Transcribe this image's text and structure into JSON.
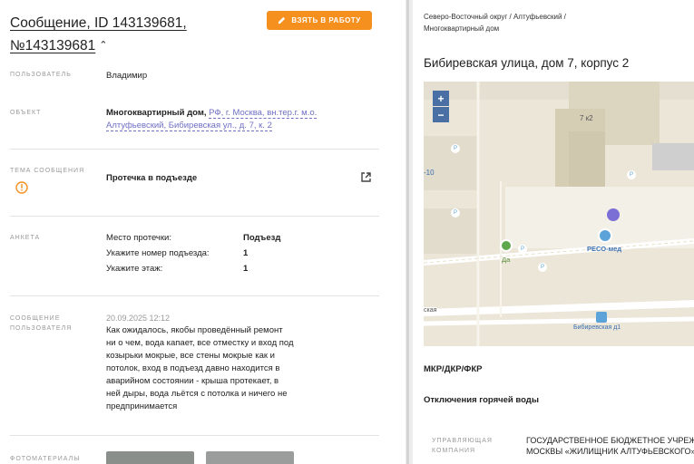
{
  "header": {
    "title_prefix": "Сообщение, ",
    "title_id": "ID 143139681,",
    "title_number": "№143139681",
    "take_button_label": "ВЗЯТЬ В РАБОТУ"
  },
  "user": {
    "label": "ПОЛЬЗОВАТЕЛЬ",
    "value": "Владимир"
  },
  "object": {
    "label": "ОБЪЕКТ",
    "type": "Многоквартирный дом,",
    "address_line1": "РФ, г. Москва, вн.тер.г. м.о.",
    "address_line2": "Алтуфьевский, Бибиревская ул., д. 7, к. 2"
  },
  "topic": {
    "label": "ТЕМА СООБЩЕНИЯ",
    "value": "Протечка в подъезде"
  },
  "survey": {
    "label": "АНКЕТА",
    "rows": [
      {
        "q": "Место протечки:",
        "a": "Подъезд"
      },
      {
        "q": "Укажите номер подъезда:",
        "a": "1"
      },
      {
        "q": "Укажите этаж:",
        "a": "1"
      }
    ]
  },
  "user_message": {
    "label_line1": "СООБЩЕНИЕ",
    "label_line2": "ПОЛЬЗОВАТЕЛЯ",
    "date": "20.09.2025 12:12",
    "lines": [
      "Как ожидалось, якобы проведённый ремонт",
      "ни о чем, вода капает, все отместку и вход под",
      "козырьки мокрые, все стены мокрые как и",
      "потолок, вход в подъезд давно находится в",
      "аварийном состоянии - крыша протекает, в",
      "ней дыры, вода льётся с потолка и ничего не",
      "предпринимается"
    ]
  },
  "photos": {
    "label": "ФОТОМАТЕРИАЛЫ"
  },
  "right": {
    "breadcrumb_line1": "Северо-Восточный округ / Алтуфьевский /",
    "breadcrumb_line2": "Многоквартирный дом",
    "address": "Бибиревская улица, дом 7, корпус 2",
    "map": {
      "zoom_in": "+",
      "zoom_out": "−",
      "building_label": "7 к2",
      "poi_reso": "РЕСО-мед",
      "poi_left": "Да",
      "street_label": "Бибиревская д1",
      "street_left": "ская",
      "left_number": "-10",
      "parking": "P"
    },
    "mkr_title": "МКР/ДКР/ФКР",
    "hot_water_title": "Отключения горячей воды",
    "company_label_line1": "УПРАВЛЯЮЩАЯ",
    "company_label_line2": "КОМПАНИЯ",
    "company_line1": "ГОСУДАРСТВЕННОЕ БЮДЖЕТНОЕ УЧРЕЖДЕНИЕ ГОРОДА",
    "company_line2": "МОСКВЫ «ЖИЛИЩНИК АЛТУФЬЕВСКОГО»"
  },
  "colors": {
    "accent": "#f5901f",
    "link": "#6f6fc4",
    "map_marker": "#7b6fd6",
    "zoom_control": "#4a6fa5"
  }
}
